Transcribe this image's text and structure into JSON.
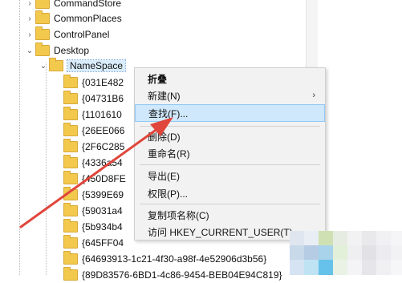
{
  "tree": {
    "items": [
      {
        "label": "CommandStore"
      },
      {
        "label": "CommonPlaces"
      },
      {
        "label": "ControlPanel"
      },
      {
        "label": "Desktop"
      },
      {
        "label": "NameSpace"
      },
      {
        "label": "{031E482"
      },
      {
        "label": "{04731B6"
      },
      {
        "label": "{1101610"
      },
      {
        "label": "{26EE066"
      },
      {
        "label": "{2F6C285"
      },
      {
        "label": "{4336a54"
      },
      {
        "label": "{450D8FE"
      },
      {
        "label": "{5399E69"
      },
      {
        "label": "{59031a4"
      },
      {
        "label": "{5b934b4"
      },
      {
        "label": "{645FF04"
      },
      {
        "label": "{64693913-1c21-4f30-a98f-4e52906d3b56}"
      },
      {
        "label": "{89D83576-6BD1-4c86-9454-BEB04E94C819}"
      }
    ]
  },
  "context_menu": {
    "items": [
      {
        "label": "折叠"
      },
      {
        "label": "新建(N)"
      },
      {
        "label": "查找(F)..."
      },
      {
        "label": "删除(D)"
      },
      {
        "label": "重命名(R)"
      },
      {
        "label": "导出(E)"
      },
      {
        "label": "权限(P)..."
      },
      {
        "label": "复制项名称(C)"
      },
      {
        "label": "访问 HKEY_CURRENT_USER(T)"
      }
    ]
  },
  "colors": {
    "annotation_arrow": "#e0463b",
    "menu_highlight": "#cfe8fc",
    "folder": "#f2c94c"
  },
  "icons": [
    "folder-icon",
    "chevron-right-icon",
    "chevron-down-icon",
    "submenu-arrow-icon"
  ]
}
